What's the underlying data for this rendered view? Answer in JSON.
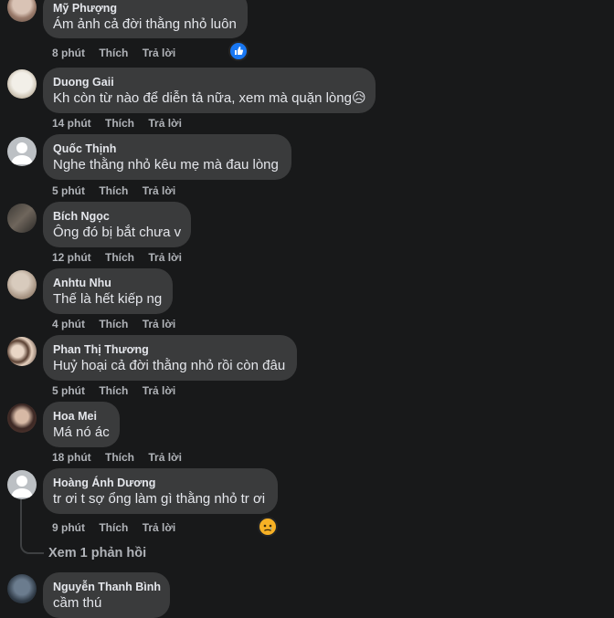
{
  "actions": {
    "like": "Thích",
    "reply": "Trả lời"
  },
  "comments": [
    {
      "name": "Mỹ Phượng",
      "text": "Ám ảnh cả đời thằng nhỏ luôn",
      "time": "8 phút",
      "reaction": "like"
    },
    {
      "name": "Duong Gaii",
      "text": "Kh còn từ nào để diễn tả nữa, xem mà quặn lòng😥",
      "time": "14 phút"
    },
    {
      "name": "Quốc Thịnh",
      "text": "Nghe thằng nhỏ kêu mẹ mà đau lòng",
      "time": "5 phút"
    },
    {
      "name": "Bích Ngọc",
      "text": "Ông đó bị bắt chưa v",
      "time": "12 phút"
    },
    {
      "name": "Anhtu Nhu",
      "text": "Thế là hết kiếp ng",
      "time": "4 phút"
    },
    {
      "name": "Phan Thị Thương",
      "text": "Huỷ hoại cả đời thằng nhỏ rồi còn đâu",
      "time": "5 phút"
    },
    {
      "name": "Hoa Mei",
      "text": "Má nó ác",
      "time": "18 phút"
    },
    {
      "name": "Hoàng Ánh Dương",
      "text": "tr ơi t sợ ổng làm gì thằng nhỏ tr ơi",
      "time": "9 phút",
      "reaction": "sad"
    },
    {
      "name": "Nguyễn Thanh Bình",
      "text": "cầm thú",
      "time": ""
    }
  ],
  "view_replies": "Xem 1 phản hồi",
  "colors": {
    "bg": "#18191a",
    "bubble": "#3a3b3c",
    "muted": "#b0b3b8",
    "like_blue": "#1877f2",
    "sad_yellow": "#f7b125"
  }
}
